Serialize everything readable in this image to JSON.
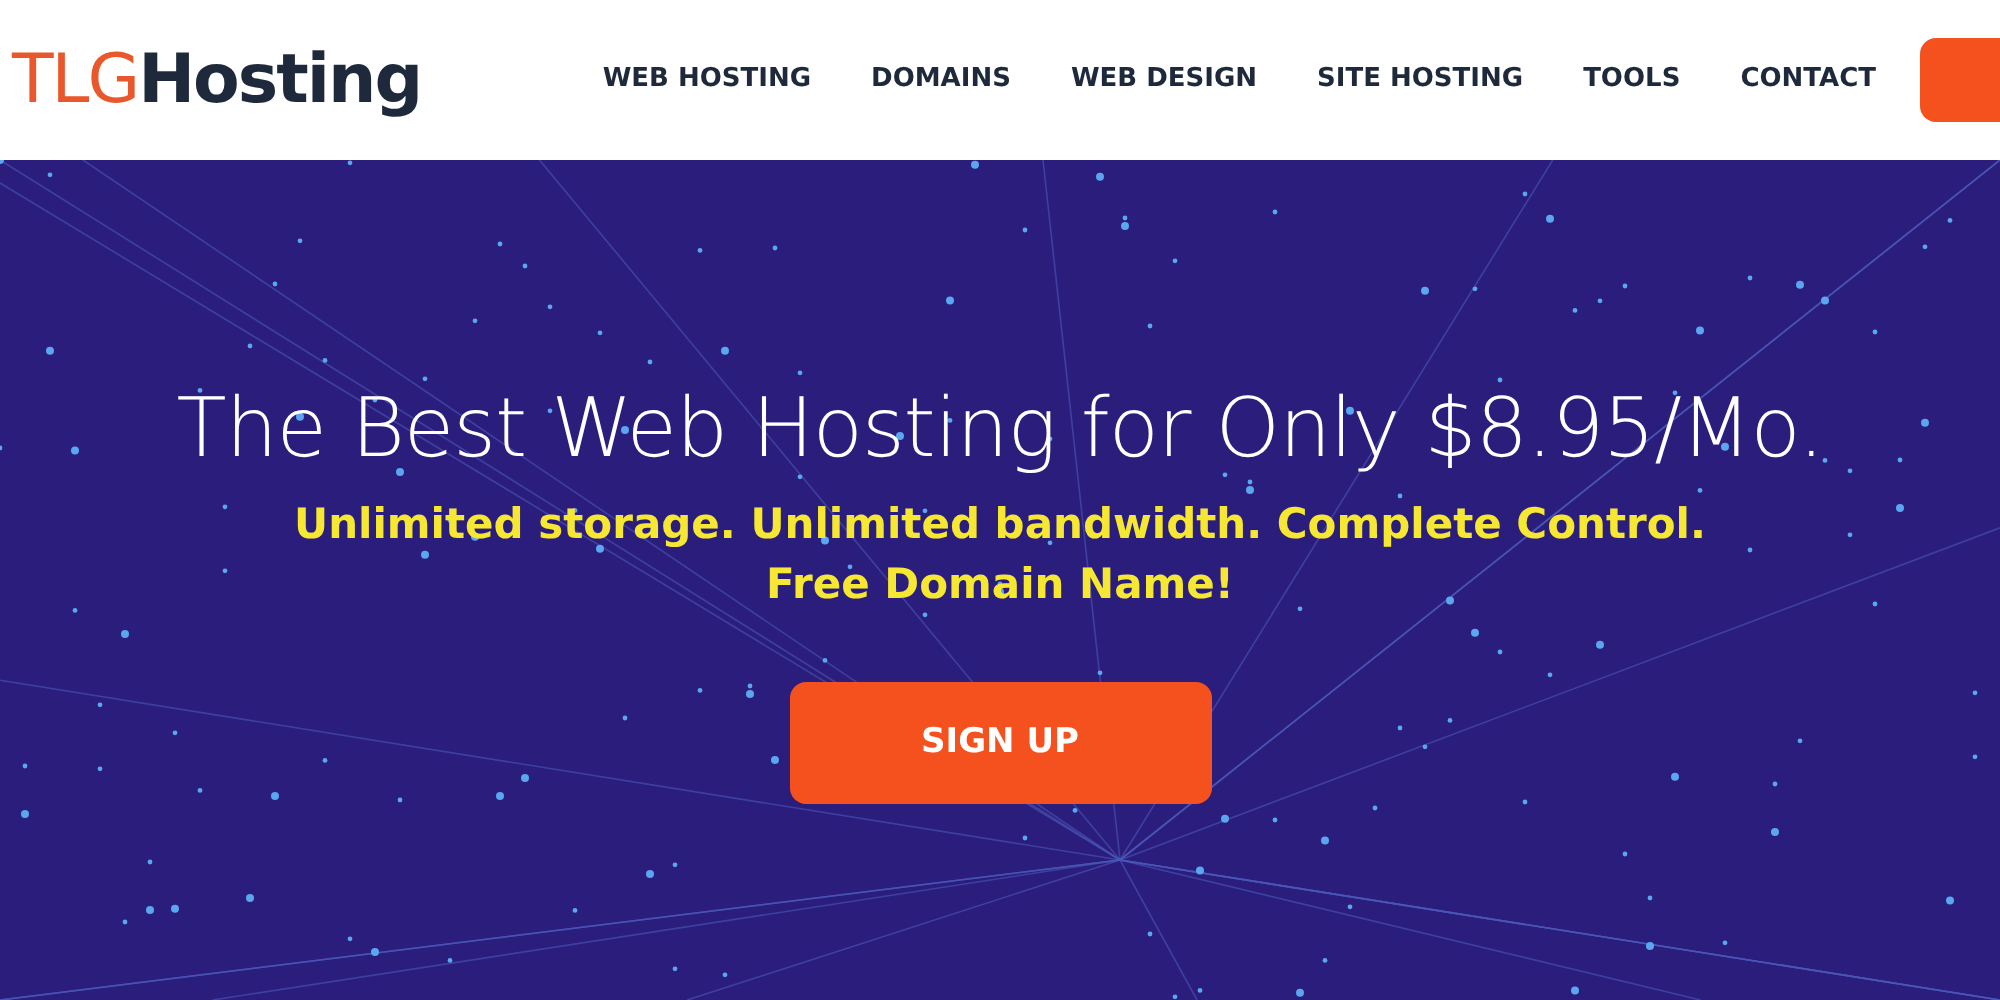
{
  "header": {
    "logo": {
      "accent": "TLG",
      "name": "Hosting"
    },
    "nav": [
      {
        "label": "WEB HOSTING"
      },
      {
        "label": "DOMAINS"
      },
      {
        "label": "WEB DESIGN"
      },
      {
        "label": "SITE HOSTING"
      },
      {
        "label": "TOOLS"
      },
      {
        "label": "CONTACT"
      }
    ]
  },
  "hero": {
    "title": "The Best Web Hosting for Only $8.95/Mo.",
    "subtitle_lines": [
      "Unlimited storage. Unlimited bandwidth. Complete Control.",
      "Free Domain Name!"
    ],
    "button": "SIGN UP"
  }
}
